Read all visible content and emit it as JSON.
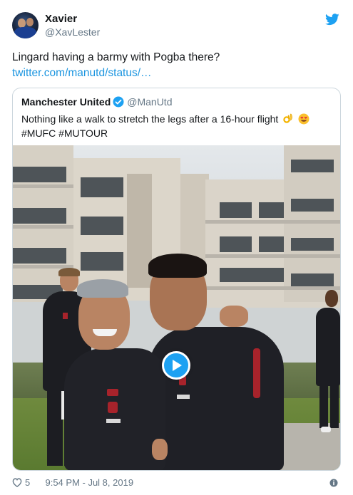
{
  "tweet": {
    "author_name": "Xavier",
    "author_handle": "@XavLester",
    "text": "Lingard having a barmy with Pogba there?",
    "link_text": "twitter.com/manutd/status/…",
    "like_count": "5",
    "timestamp": "9:54 PM - Jul 8, 2019"
  },
  "quoted_tweet": {
    "author_name": "Manchester United",
    "author_handle": "@ManUtd",
    "text": "Nothing like a walk to stretch the legs after a 16-hour flight",
    "emoji": [
      "ok-hand-emoji",
      "smiling-face-with-heart-eyes-emoji"
    ],
    "hashtags": "#MUFC #MUTOUR",
    "media_type": "video"
  },
  "colors": {
    "link": "#1b95e0",
    "twitter_blue": "#1da1f2",
    "muted": "#657786",
    "border": "#ccd6dd"
  },
  "icons": [
    "twitter-bird-icon",
    "verified-badge-icon",
    "play-icon",
    "heart-icon",
    "info-icon"
  ]
}
